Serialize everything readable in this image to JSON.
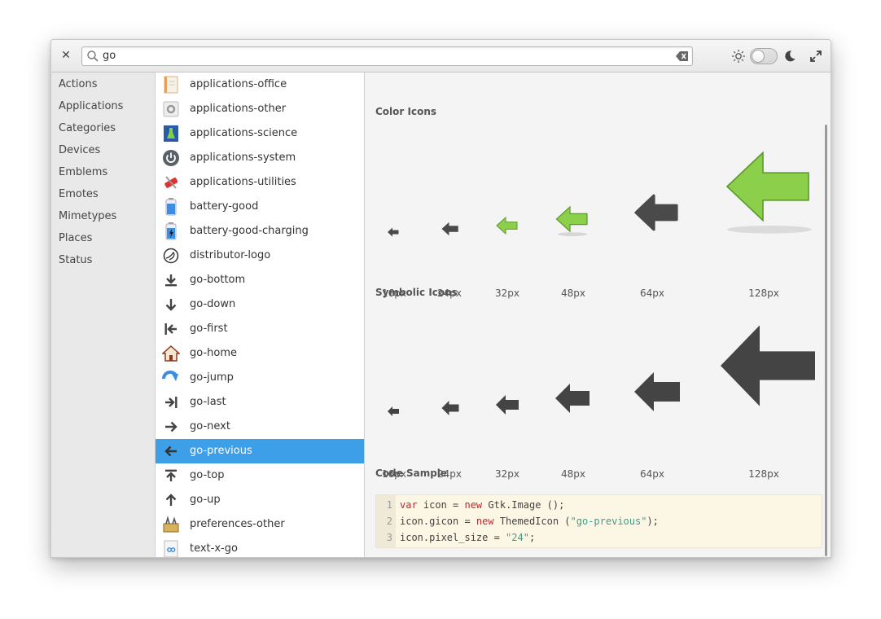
{
  "search": {
    "query": "go"
  },
  "sidebar": {
    "items": [
      "Actions",
      "Applications",
      "Categories",
      "Devices",
      "Emblems",
      "Emotes",
      "Mimetypes",
      "Places",
      "Status"
    ]
  },
  "list": {
    "items": [
      {
        "label": "applications-office",
        "icon": "office-icon"
      },
      {
        "label": "applications-other",
        "icon": "gear-icon"
      },
      {
        "label": "applications-science",
        "icon": "flask-icon"
      },
      {
        "label": "applications-system",
        "icon": "power-icon"
      },
      {
        "label": "applications-utilities",
        "icon": "tools-icon"
      },
      {
        "label": "battery-good",
        "icon": "battery-icon"
      },
      {
        "label": "battery-good-charging",
        "icon": "battery-charging-icon"
      },
      {
        "label": "distributor-logo",
        "icon": "elementary-logo-icon"
      },
      {
        "label": "go-bottom",
        "icon": "arrow-bottom-icon"
      },
      {
        "label": "go-down",
        "icon": "arrow-down-icon"
      },
      {
        "label": "go-first",
        "icon": "arrow-first-icon"
      },
      {
        "label": "go-home",
        "icon": "home-icon"
      },
      {
        "label": "go-jump",
        "icon": "jump-icon"
      },
      {
        "label": "go-last",
        "icon": "arrow-last-icon"
      },
      {
        "label": "go-next",
        "icon": "arrow-next-icon"
      },
      {
        "label": "go-previous",
        "icon": "arrow-previous-icon",
        "selected": true
      },
      {
        "label": "go-top",
        "icon": "arrow-top-icon"
      },
      {
        "label": "go-up",
        "icon": "arrow-up-icon"
      },
      {
        "label": "preferences-other",
        "icon": "toolbox-icon"
      },
      {
        "label": "text-x-go",
        "icon": "go-file-icon"
      }
    ]
  },
  "detail": {
    "color_title": "Color Icons",
    "symbolic_title": "Symbolic Icons",
    "code_title": "Code Sample",
    "sizes": [
      "16px",
      "24px",
      "32px",
      "48px",
      "64px",
      "128px"
    ],
    "code_lines": [
      {
        "n": "1",
        "parts": [
          [
            "kw",
            "var"
          ],
          [
            "",
            "  icon = "
          ],
          [
            "kw",
            "new"
          ],
          [
            "",
            " Gtk.Image ();"
          ]
        ]
      },
      {
        "n": "2",
        "parts": [
          [
            "",
            "icon.gicon = "
          ],
          [
            "kw",
            "new"
          ],
          [
            "",
            " ThemedIcon ("
          ],
          [
            "str",
            "\"go-previous\""
          ],
          [
            "",
            ");"
          ]
        ]
      },
      {
        "n": "3",
        "parts": [
          [
            "",
            "icon.pixel_size = "
          ],
          [
            "str",
            "\"24\""
          ],
          [
            "",
            ";"
          ]
        ]
      }
    ]
  },
  "colors": {
    "accent": "#3d9fe7",
    "arrow_green": "#8ccf4a",
    "symbolic": "#444444"
  }
}
